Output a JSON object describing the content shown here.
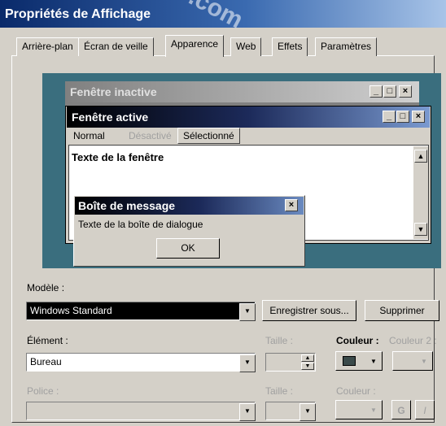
{
  "window": {
    "title": "Propriétés de Affichage",
    "watermark": ".com"
  },
  "tabs": [
    {
      "label": "Arrière-plan"
    },
    {
      "label": "Écran de veille"
    },
    {
      "label": "Apparence"
    },
    {
      "label": "Web"
    },
    {
      "label": "Effets"
    },
    {
      "label": "Paramètres"
    }
  ],
  "preview": {
    "inactive_title": "Fenêtre inactive",
    "active_title": "Fenêtre active",
    "menu": {
      "normal": "Normal",
      "disabled": "Désactivé",
      "selected": "Sélectionné"
    },
    "window_text": "Texte de la fenêtre",
    "msgbox": {
      "title": "Boîte de message",
      "text": "Texte de la boîte de dialogue",
      "ok": "OK"
    },
    "colors": {
      "desktop": "#3a6e7e",
      "active_title": "#000000",
      "inactive_title": "#808080"
    }
  },
  "scheme": {
    "label": "Modèle :",
    "value": "Windows Standard",
    "save_button": "Enregistrer sous...",
    "delete_button": "Supprimer"
  },
  "item": {
    "label": "Élément :",
    "value": "Bureau",
    "size_label": "Taille :",
    "color_label": "Couleur :",
    "color2_label": "Couleur 2 :"
  },
  "font": {
    "label": "Police :",
    "size_label": "Taille :",
    "color_label": "Couleur :",
    "bold_button": "G",
    "italic_button": "I"
  }
}
